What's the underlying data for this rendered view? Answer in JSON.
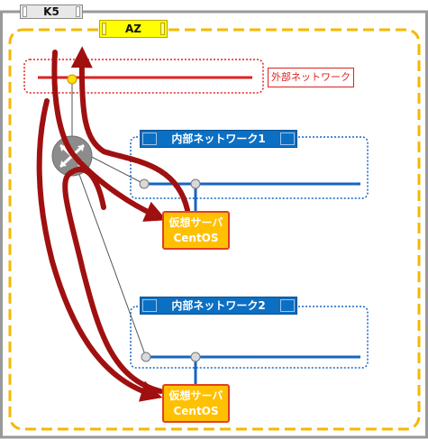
{
  "region_label": "K5",
  "zone_label": "AZ",
  "external_network": {
    "label": "外部ネットワーク"
  },
  "internal_networks": [
    {
      "label": "内部ネットワーク1"
    },
    {
      "label": "内部ネットワーク2"
    }
  ],
  "servers": [
    {
      "line1": "仮想サーバ",
      "line2": "CentOS"
    },
    {
      "line1": "仮想サーバ",
      "line2": "CentOS"
    }
  ],
  "colors": {
    "zone_border": "#f5b800",
    "external_network": "#e02020",
    "internal_network": "#1565c0",
    "traffic_arrow": "#a01010",
    "server_fill": "#ffc000"
  }
}
